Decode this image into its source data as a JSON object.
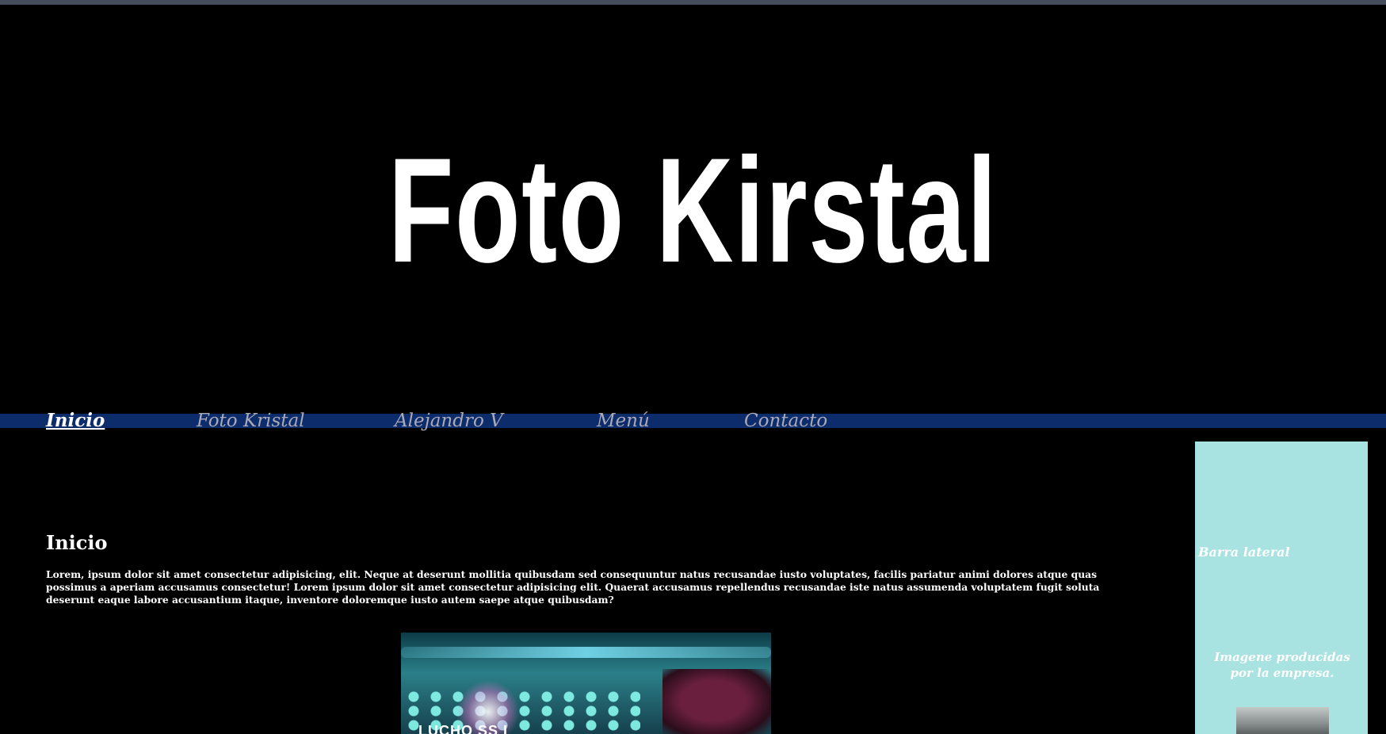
{
  "header": {
    "title": "Foto Kirstal"
  },
  "nav": {
    "items": [
      {
        "label": "Inicio",
        "active": true
      },
      {
        "label": "Foto Kristal",
        "active": false
      },
      {
        "label": "Alejandro V",
        "active": false
      },
      {
        "label": "Menú",
        "active": false
      },
      {
        "label": "Contacto",
        "active": false
      }
    ]
  },
  "main": {
    "heading": "Inicio",
    "body": "Lorem, ipsum dolor sit amet consectetur adipisicing, elit. Neque at deserunt mollitia quibusdam sed consequuntur natus recusandae iusto voluptates, facilis pariatur animi dolores atque quas possimus a aperiam accusamus consectetur! Lorem ipsum dolor sit amet consectetur adipisicing elit. Quaerat accusamus repellendus recusandae iste natus assumenda voluptatem fugit soluta deserunt eaque labore accusantium itaque, inventore doloremque iusto autem saepe atque quibusdam?",
    "image_caption": "LUCHO SS I"
  },
  "sidebar": {
    "title": "Barra lateral",
    "caption": "Imagene producidas por la empresa."
  },
  "colors": {
    "background": "#000000",
    "nav_bar": "#0d2c6b",
    "nav_text": "#a9a9b8",
    "sidebar_bg": "#a9e3e1",
    "text": "#ffffff"
  }
}
